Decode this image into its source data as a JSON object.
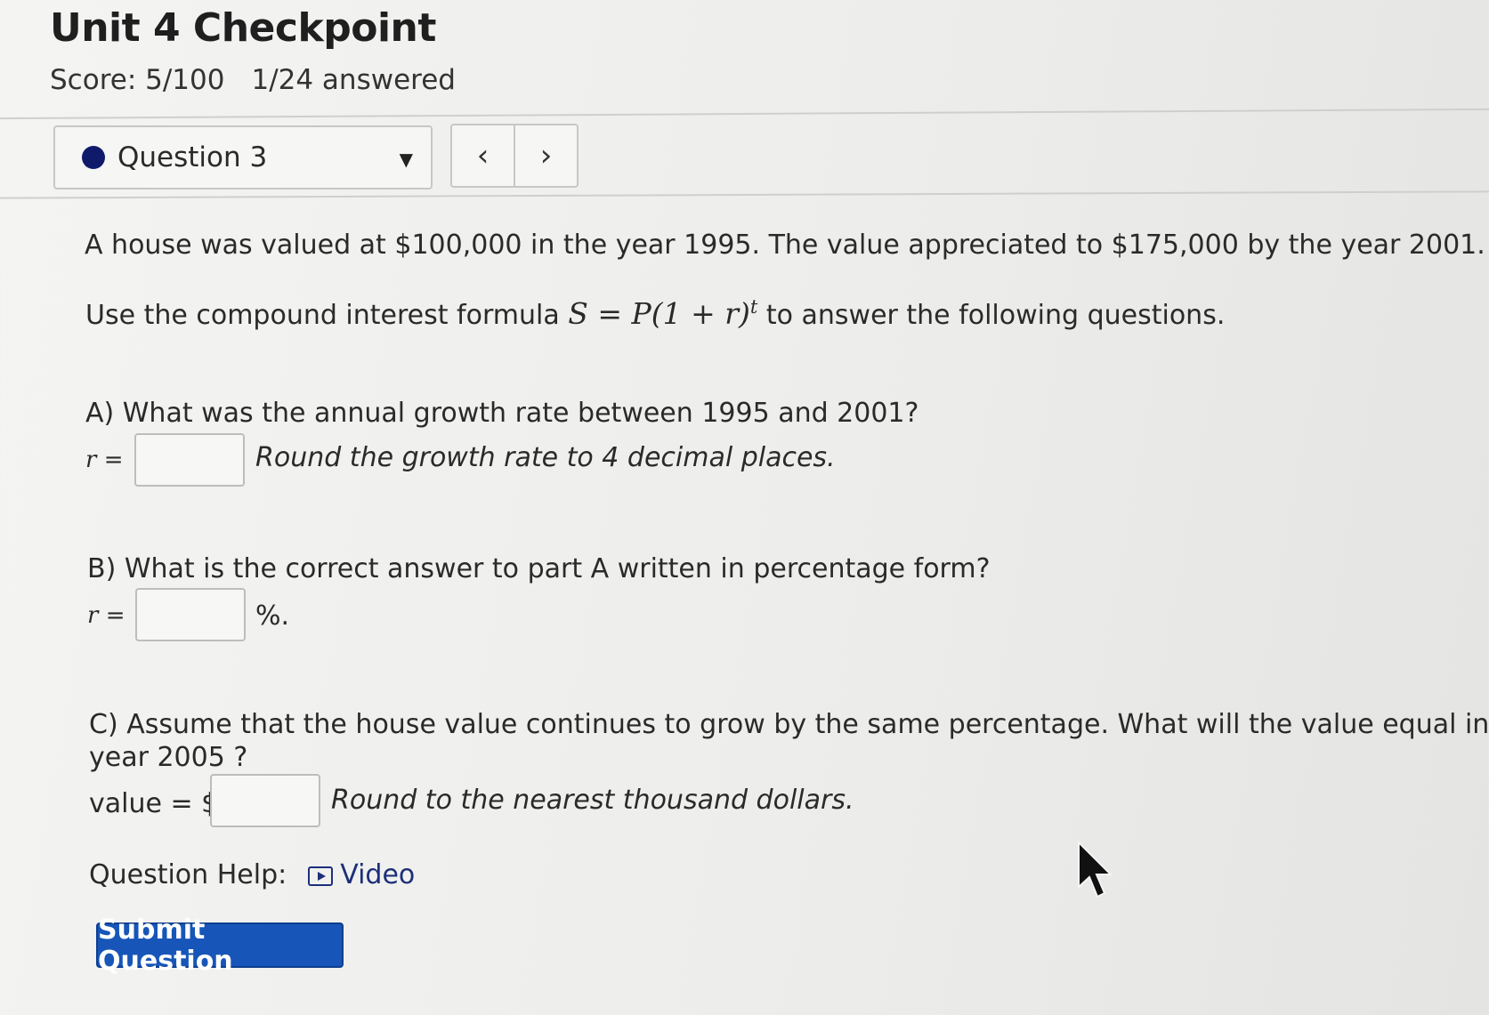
{
  "header": {
    "title": "Unit 4 Checkpoint",
    "score": "Score: 5/100",
    "answered": "1/24 answered"
  },
  "question_nav": {
    "selected_question": "Question 3",
    "status_color": "#0f1a6a",
    "dropdown_icon": "caret-down-icon",
    "prev_icon": "‹",
    "next_icon": "›"
  },
  "problem": {
    "intro": "A house was valued at $100,000 in the year 1995. The value appreciated to $175,000 by the year 2001.",
    "formula_prefix": "Use the compound interest formula ",
    "formula_base": "S = P(1 + r)",
    "formula_exp": "t",
    "formula_suffix": " to answer the following questions."
  },
  "part_a": {
    "question": "A) What was the annual growth rate between 1995 and 2001?",
    "var_label": "r",
    "equals": " =",
    "input_value": "",
    "hint": "Round the growth rate to 4 decimal places."
  },
  "part_b": {
    "question": "B) What is the correct answer to part A written in percentage form?",
    "var_label": "r",
    "equals": " =",
    "input_value": "",
    "suffix": "%."
  },
  "part_c": {
    "question_line1": "C) Assume that the house value continues to grow by the same percentage. What will the value equal in the",
    "question_line2": "year 2005 ?",
    "label": "value = $",
    "input_value": "",
    "hint": "Round to the nearest thousand dollars."
  },
  "help": {
    "label": "Question Help:",
    "icon": "video-play-icon",
    "link_text": "Video",
    "link_color": "#1c2f7a"
  },
  "submit": {
    "label": "Submit Question",
    "color": "#1756b8"
  }
}
